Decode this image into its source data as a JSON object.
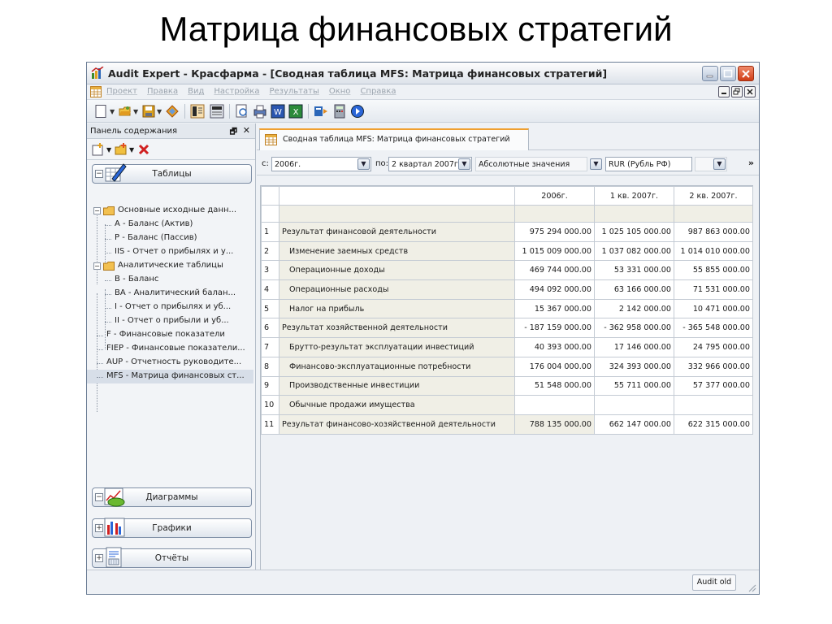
{
  "slide_title": "Матрица финансовых стратегий",
  "window": {
    "title": "Audit Expert - Красфарма  - [Сводная таблица MFS: Матрица финансовых стратегий]"
  },
  "menu": [
    "Проект",
    "Правка",
    "Вид",
    "Настройка",
    "Результаты",
    "Окно",
    "Справка"
  ],
  "left_panel": {
    "header": "Панель содержания",
    "groups": {
      "tables": "Таблицы",
      "diagrams": "Диаграммы",
      "graphs": "Графики",
      "reports": "Отчёты"
    },
    "tree": [
      "Основные исходные данн...",
      "А - Баланс (Актив)",
      "Р - Баланс (Пассив)",
      "IIS - Отчет о прибылях и у...",
      "Аналитические таблицы",
      "В - Баланс",
      "ВА - Аналитический балан...",
      "I - Отчет о прибылях и уб...",
      "II - Отчет о прибыли и уб...",
      "F - Финансовые показатели",
      "FIEP - Финансовые показатели...",
      "AUP - Отчетность руководите...",
      "MFS - Матрица финансовых ст..."
    ]
  },
  "tab": {
    "label": "Сводная таблица MFS: Матрица финансовых стратегий"
  },
  "filter": {
    "from_label": "с:",
    "from_value": "2006г.",
    "to_label": "по:",
    "to_value": "2 квартал 2007г.",
    "mode_value": "Абсолютные значения",
    "currency_value": "RUR (Рубль РФ)",
    "more": "»"
  },
  "table": {
    "columns": [
      "2006г.",
      "1 кв. 2007г.",
      "2 кв. 2007г."
    ],
    "rows": [
      {
        "n": "1",
        "name": "Результат финансовой деятельности",
        "v": [
          "975 294 000.00",
          "1 025 105 000.00",
          "987 863 000.00"
        ]
      },
      {
        "n": "2",
        "name": "Изменение заемных средств",
        "v": [
          "1 015 009 000.00",
          "1 037 082 000.00",
          "1 014 010 000.00"
        ]
      },
      {
        "n": "3",
        "name": "Операционные доходы",
        "v": [
          "469 744 000.00",
          "53 331 000.00",
          "55 855 000.00"
        ]
      },
      {
        "n": "4",
        "name": "Операционные расходы",
        "v": [
          "494 092 000.00",
          "63 166 000.00",
          "71 531 000.00"
        ]
      },
      {
        "n": "5",
        "name": "Налог на прибыль",
        "v": [
          "15 367 000.00",
          "2 142 000.00",
          "10 471 000.00"
        ]
      },
      {
        "n": "6",
        "name": "Результат хозяйственной деятельности",
        "v": [
          "- 187 159 000.00",
          "- 362 958 000.00",
          "- 365 548 000.00"
        ]
      },
      {
        "n": "7",
        "name": "Брутто-результат эксплуатации инвестиций",
        "v": [
          "40 393 000.00",
          "17 146 000.00",
          "24 795 000.00"
        ]
      },
      {
        "n": "8",
        "name": "Финансово-эксплуатационные потребности",
        "v": [
          "176 004 000.00",
          "324 393 000.00",
          "332 966 000.00"
        ]
      },
      {
        "n": "9",
        "name": "Производственные инвестиции",
        "v": [
          "51 548 000.00",
          "55 711 000.00",
          "57 377 000.00"
        ]
      },
      {
        "n": "10",
        "name": "Обычные продажи имущества",
        "v": [
          "",
          "",
          ""
        ]
      },
      {
        "n": "11",
        "name": "Результат финансово-хозяйственной деятельности",
        "v": [
          "788 135 000.00",
          "662 147 000.00",
          "622 315 000.00"
        ]
      }
    ]
  },
  "status": {
    "button": "Audit old"
  }
}
